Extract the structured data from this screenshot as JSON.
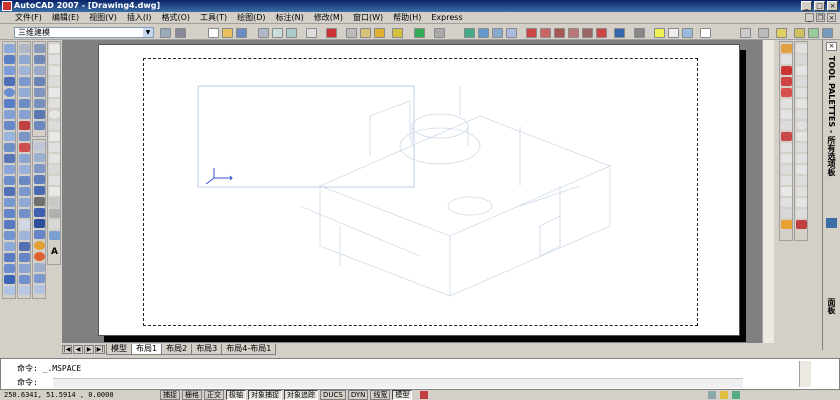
{
  "window": {
    "title": "AutoCAD 2007 - [Drawing4.dwg]",
    "min": "_",
    "max": "□",
    "close": "×"
  },
  "menu": [
    "文件(F)",
    "编辑(E)",
    "视图(V)",
    "插入(I)",
    "格式(O)",
    "工具(T)",
    "绘图(D)",
    "标注(N)",
    "修改(M)",
    "窗口(W)",
    "帮助(H)",
    "Express"
  ],
  "mdi": {
    "min": "_",
    "restore": "❐",
    "close": "×"
  },
  "workspace": {
    "value": "三维建模"
  },
  "tabs": {
    "nav": [
      "|◀",
      "◀",
      "▶",
      "▶|"
    ],
    "items": [
      {
        "label": "模型",
        "active": false
      },
      {
        "label": "布局1",
        "active": true
      },
      {
        "label": "布局2",
        "active": false
      },
      {
        "label": "布局3",
        "active": false
      },
      {
        "label": "布局4-布局1",
        "active": false
      }
    ]
  },
  "command": {
    "line1": "命令: _.MSPACE",
    "line2": "命令:"
  },
  "status": {
    "coords": "250.6341, 51.5914 , 0.0000",
    "buttons": [
      {
        "label": "捕捉",
        "on": false
      },
      {
        "label": "栅格",
        "on": false
      },
      {
        "label": "正交",
        "on": false
      },
      {
        "label": "极轴",
        "on": true
      },
      {
        "label": "对象捕捉",
        "on": true
      },
      {
        "label": "对象追踪",
        "on": true
      },
      {
        "label": "DUCS",
        "on": false
      },
      {
        "label": "DYN",
        "on": false
      },
      {
        "label": "线宽",
        "on": false
      },
      {
        "label": "模型",
        "on": true
      }
    ]
  },
  "palette": {
    "title": "TOOL PALETTES - 所有选项板",
    "tab": "面板"
  },
  "colors": {
    "title_start": "#0a246a",
    "title_end": "#3a6ea5",
    "drawing_lines": "#bcd0e8"
  }
}
